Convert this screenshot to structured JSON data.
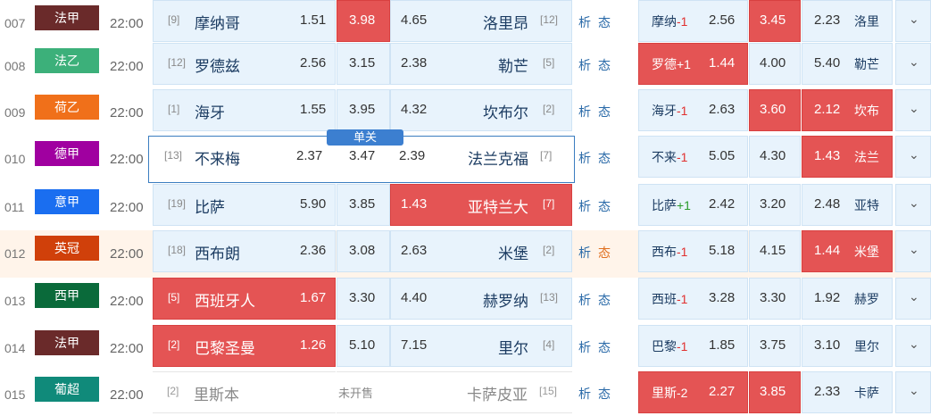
{
  "colors": {
    "cell_bg": "#e8f3fc",
    "highlight_red": "#e45454",
    "link_blue": "#2a6aa8",
    "single_badge": "#3c7fd0"
  },
  "single_badge": "单关",
  "analysis_label": "析",
  "trend_label": "态",
  "expand_icon": "chevron-down-icon",
  "not_on_sale": "未开售",
  "rows": [
    {
      "num": "007",
      "league": "法甲",
      "league_color": "#6a2a2a",
      "time": "22:00",
      "home_rank": "[9]",
      "home": "摩纳哥",
      "home_odd": "1.51",
      "draw_odd": "3.98",
      "away_odd": "4.65",
      "away": "洛里昂",
      "away_rank": "[12]",
      "hc_team": "摩纳",
      "hc_value": "-1",
      "hc_home": "2.56",
      "hc_draw": "3.45",
      "hc_away": "2.23",
      "hc_away_team": "洛里"
    },
    {
      "num": "008",
      "league": "法乙",
      "league_color": "#3cb07a",
      "time": "22:00",
      "home_rank": "[12]",
      "home": "罗德兹",
      "home_odd": "2.56",
      "draw_odd": "3.15",
      "away_odd": "2.38",
      "away": "勒芒",
      "away_rank": "[5]",
      "hc_team": "罗德",
      "hc_value": "+1",
      "hc_home": "1.44",
      "hc_draw": "4.00",
      "hc_away": "5.40",
      "hc_away_team": "勒芒"
    },
    {
      "num": "009",
      "league": "荷乙",
      "league_color": "#f0701a",
      "time": "22:00",
      "home_rank": "[1]",
      "home": "海牙",
      "home_odd": "1.55",
      "draw_odd": "3.95",
      "away_odd": "4.32",
      "away": "坎布尔",
      "away_rank": "[2]",
      "hc_team": "海牙",
      "hc_value": "-1",
      "hc_home": "2.63",
      "hc_draw": "3.60",
      "hc_away": "2.12",
      "hc_away_team": "坎布"
    },
    {
      "num": "010",
      "league": "德甲",
      "league_color": "#a000a0",
      "time": "22:00",
      "home_rank": "[13]",
      "home": "不来梅",
      "home_odd": "2.37",
      "draw_odd": "3.47",
      "away_odd": "2.39",
      "away": "法兰克福",
      "away_rank": "[7]",
      "hc_team": "不来",
      "hc_value": "-1",
      "hc_home": "5.05",
      "hc_draw": "4.30",
      "hc_away": "1.43",
      "hc_away_team": "法兰"
    },
    {
      "num": "011",
      "league": "意甲",
      "league_color": "#1a6ef0",
      "time": "22:00",
      "home_rank": "[19]",
      "home": "比萨",
      "home_odd": "5.90",
      "draw_odd": "3.85",
      "away_odd": "1.43",
      "away": "亚特兰大",
      "away_rank": "[7]",
      "hc_team": "比萨",
      "hc_value": "+1",
      "hc_home": "2.42",
      "hc_draw": "3.20",
      "hc_away": "2.48",
      "hc_away_team": "亚特"
    },
    {
      "num": "012",
      "league": "英冠",
      "league_color": "#d0400a",
      "time": "22:00",
      "home_rank": "[18]",
      "home": "西布朗",
      "home_odd": "2.36",
      "draw_odd": "3.08",
      "away_odd": "2.63",
      "away": "米堡",
      "away_rank": "[2]",
      "hc_team": "西布",
      "hc_value": "-1",
      "hc_home": "5.18",
      "hc_draw": "4.15",
      "hc_away": "1.44",
      "hc_away_team": "米堡"
    },
    {
      "num": "013",
      "league": "西甲",
      "league_color": "#0a6a3a",
      "time": "22:00",
      "home_rank": "[5]",
      "home": "西班牙人",
      "home_odd": "1.67",
      "draw_odd": "3.30",
      "away_odd": "4.40",
      "away": "赫罗纳",
      "away_rank": "[13]",
      "hc_team": "西班",
      "hc_value": "-1",
      "hc_home": "3.28",
      "hc_draw": "3.30",
      "hc_away": "1.92",
      "hc_away_team": "赫罗"
    },
    {
      "num": "014",
      "league": "法甲",
      "league_color": "#6a2a2a",
      "time": "22:00",
      "home_rank": "[2]",
      "home": "巴黎圣曼",
      "home_odd": "1.26",
      "draw_odd": "5.10",
      "away_odd": "7.15",
      "away": "里尔",
      "away_rank": "[4]",
      "hc_team": "巴黎",
      "hc_value": "-1",
      "hc_home": "1.85",
      "hc_draw": "3.75",
      "hc_away": "3.10",
      "hc_away_team": "里尔"
    },
    {
      "num": "015",
      "league": "葡超",
      "league_color": "#108a7a",
      "time": "22:00",
      "home_rank": "[2]",
      "home": "里斯本",
      "away": "卡萨皮亚",
      "away_rank": "[15]",
      "hc_team": "里斯",
      "hc_value": "-2",
      "hc_home": "2.27",
      "hc_draw": "3.85",
      "hc_away": "2.33",
      "hc_away_team": "卡萨"
    }
  ]
}
